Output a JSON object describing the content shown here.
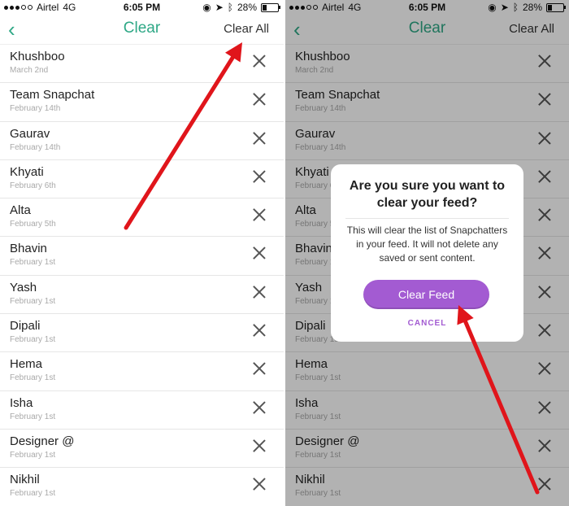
{
  "status_bar": {
    "carrier": "Airtel",
    "network": "4G",
    "time": "6:05 PM",
    "battery": "28%"
  },
  "nav": {
    "title": "Clear",
    "action": "Clear All",
    "back_icon": "chevron-left-icon"
  },
  "contacts": [
    {
      "name": "Khushboo",
      "date": "March 2nd"
    },
    {
      "name": "Team Snapchat",
      "date": "February 14th"
    },
    {
      "name": "Gaurav",
      "date": "February 14th"
    },
    {
      "name": "Khyati",
      "date": "February 6th"
    },
    {
      "name": "Alta",
      "date": "February 5th"
    },
    {
      "name": "Bhavin",
      "date": "February 1st"
    },
    {
      "name": "Yash",
      "date": "February 1st"
    },
    {
      "name": "Dipali",
      "date": "February 1st"
    },
    {
      "name": "Hema",
      "date": "February 1st"
    },
    {
      "name": "Isha",
      "date": "February 1st"
    },
    {
      "name": "Designer @",
      "date": "February 1st"
    },
    {
      "name": "Nikhil",
      "date": "February 1st"
    }
  ],
  "dialog": {
    "title": "Are you sure you want to clear your feed?",
    "body": "This will clear the list of Snapchatters in your feed. It will not delete any saved or sent content.",
    "confirm": "Clear Feed",
    "cancel": "CANCEL"
  },
  "colors": {
    "accent": "#2fa886",
    "purple": "#a35bd2",
    "arrow": "#e0151b"
  }
}
